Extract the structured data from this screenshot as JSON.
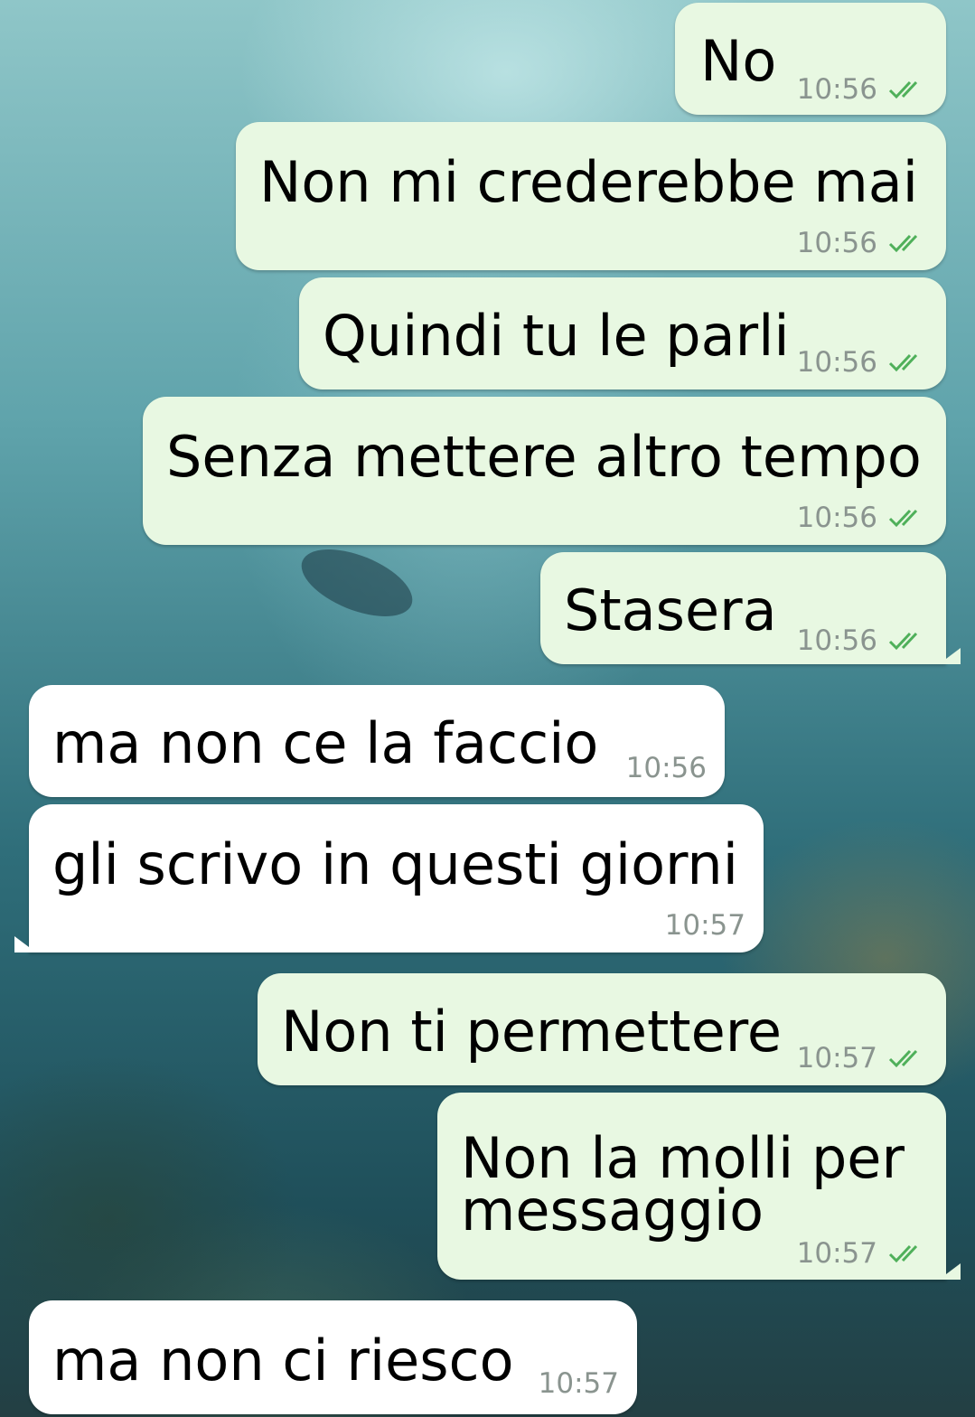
{
  "chat": {
    "messages": [
      {
        "direction": "outgoing",
        "text": "No",
        "time": "10:56",
        "status": "read-double-check-icon"
      },
      {
        "direction": "outgoing",
        "text": "Non mi crederebbe mai",
        "time": "10:56",
        "status": "read-double-check-icon"
      },
      {
        "direction": "outgoing",
        "text": "Quindi tu le parli",
        "time": "10:56",
        "status": "read-double-check-icon"
      },
      {
        "direction": "outgoing",
        "text": "Senza mettere altro tempo",
        "time": "10:56",
        "status": "read-double-check-icon"
      },
      {
        "direction": "outgoing",
        "text": "Stasera",
        "time": "10:56",
        "status": "read-double-check-icon"
      },
      {
        "direction": "incoming",
        "text": "ma non ce la faccio",
        "time": "10:56"
      },
      {
        "direction": "incoming",
        "text": "gli scrivo in questi giorni",
        "time": "10:57"
      },
      {
        "direction": "outgoing",
        "text": "Non ti permettere",
        "time": "10:57",
        "status": "read-double-check-icon"
      },
      {
        "direction": "outgoing",
        "text_line1": "Non la molli per",
        "text_line2": "messaggio",
        "time": "10:57",
        "status": "read-double-check-icon"
      },
      {
        "direction": "incoming",
        "text": "ma non ci riesco",
        "time": "10:57"
      }
    ]
  },
  "colors": {
    "outgoing_bubble": "#e8f8e2",
    "incoming_bubble": "#ffffff",
    "timestamp": "#8a948f",
    "read_ticks": "#4fb05a"
  }
}
